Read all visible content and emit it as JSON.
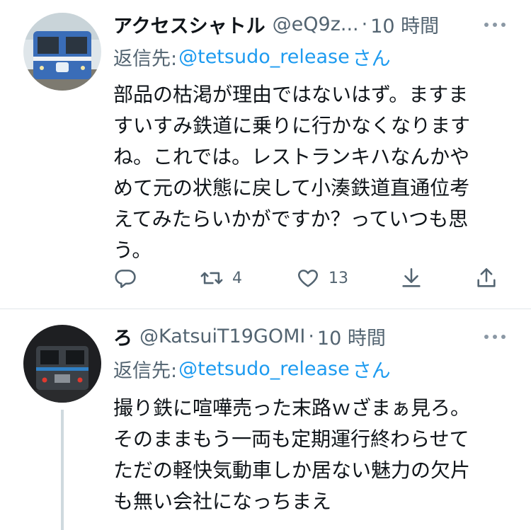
{
  "tweets": [
    {
      "display_name": "アクセスシャトル",
      "handle": "@eQ9z...",
      "separator": "·",
      "time": "10 時間",
      "reply_label": "返信先:",
      "reply_mention": "@tetsudo_release",
      "reply_suffix": "さん",
      "lines": [
        "部品の枯渇が理由ではないはず。ますま",
        "すいすみ鉄道に乗りに行かなくなります",
        "ね。これでは。レストランキハなんかや",
        "めて元の状態に戻して小湊鉄道直通位考",
        "えてみたらいかがですか？っていつも思",
        "う。"
      ],
      "actions": {
        "reply_icon": "reply-icon",
        "retweet_icon": "retweet-icon",
        "retweet_count": "4",
        "like_icon": "heart-icon",
        "like_count": "13",
        "download_icon": "download-icon",
        "share_icon": "share-icon"
      }
    },
    {
      "display_name": "ろ",
      "handle": "@KatsuiT19GOMI",
      "separator": "·",
      "time": "10 時間",
      "reply_label": "返信先:",
      "reply_mention": "@tetsudo_release",
      "reply_suffix": "さん",
      "lines": [
        "撮り鉄に喧嘩売った末路ｗざまぁ見ろ。",
        "そのままもう一両も定期運行終わらせて",
        "ただの軽快気動車しか居ない魅力の欠片",
        "も無い会社になっちまえ"
      ]
    }
  ],
  "colors": {
    "text": "#0f1419",
    "secondary": "#536471",
    "link": "#1d9bf0",
    "divider": "#e1e6ea"
  }
}
